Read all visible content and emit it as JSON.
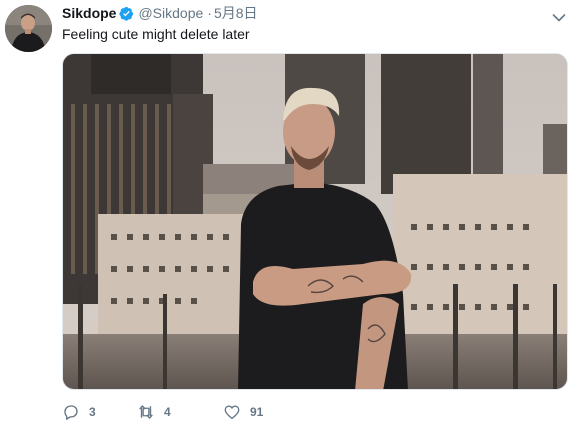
{
  "author": {
    "display_name": "Sikdope",
    "handle": "@Sikdope",
    "separator": "·",
    "date": "5月8日",
    "verified": true
  },
  "tweet": {
    "text": "Feeling cute might delete later"
  },
  "actions": {
    "reply_count": "3",
    "retweet_count": "4",
    "like_count": "91"
  },
  "colors": {
    "verified_blue": "#1da1f2",
    "secondary_text": "#657786",
    "primary_text": "#14171a"
  },
  "icons": {
    "reply": "reply-icon",
    "retweet": "retweet-icon",
    "like": "like-icon",
    "menu": "chevron-down-icon",
    "verified": "verified-badge-icon"
  }
}
